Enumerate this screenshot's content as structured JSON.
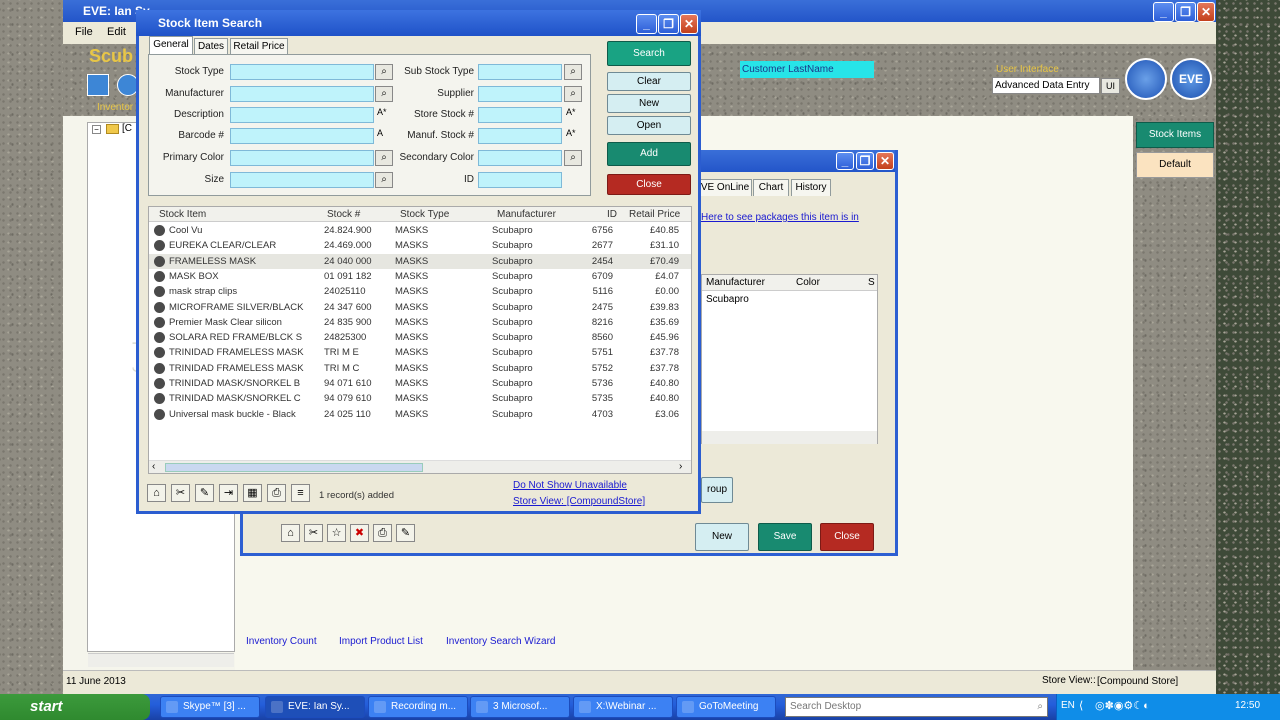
{
  "app": {
    "title": "EVE: Ian Sy",
    "title_suffix": "...",
    "menu": [
      "File",
      "Edit"
    ],
    "banner_title": "Scub",
    "side_text": "EVE Electronic Virtual Employee 5.8",
    "tree_root": "[C",
    "inventory_tab": "Inventor",
    "customer_label": "Customer LastName",
    "user_interface_label": "User Interface",
    "user_interface_value": "Advanced Data Entry",
    "ui_button": "UI",
    "right_buttons": [
      "Stock Items",
      "Default"
    ],
    "bottom_links": [
      "Inventory Count",
      "Import Product List",
      "Inventory Search Wizard"
    ],
    "status_date": "11 June 2013",
    "status_store_label": "Store View::",
    "status_store_value": "[Compound Store]",
    "logo_text": "EVE"
  },
  "edit_window": {
    "tabs": [
      "VE OnLine",
      "Chart",
      "History"
    ],
    "link": "Here to see packages this item is in",
    "columns": [
      "Manufacturer",
      "Color",
      "S"
    ],
    "row_manufacturer": "Scubapro",
    "group_button": "roup",
    "buttons": {
      "new": "New",
      "save": "Save",
      "close": "Close"
    }
  },
  "dialog": {
    "title": "Stock Item Search",
    "tabs": [
      "General",
      "Dates",
      "Retail Price"
    ],
    "fields_left": [
      {
        "label": "Stock Type",
        "lookup": true
      },
      {
        "label": "Manufacturer",
        "lookup": true
      },
      {
        "label": "Description",
        "lookup": false,
        "mark": "A*"
      },
      {
        "label": "Barcode #",
        "lookup": false,
        "mark": "A"
      },
      {
        "label": "Primary Color",
        "lookup": true
      },
      {
        "label": "Size",
        "lookup": true
      }
    ],
    "fields_right": [
      {
        "label": "Sub Stock Type",
        "lookup": true
      },
      {
        "label": "Supplier",
        "lookup": true
      },
      {
        "label": "Store Stock #",
        "lookup": false,
        "mark": "A*"
      },
      {
        "label": "Manuf. Stock #",
        "lookup": false,
        "mark": "A*"
      },
      {
        "label": "Secondary Color",
        "lookup": true
      },
      {
        "label": "ID",
        "lookup": false
      }
    ],
    "buttons": {
      "search": "Search",
      "clear": "Clear",
      "new": "New",
      "open": "Open",
      "add": "Add",
      "close": "Close"
    },
    "columns": [
      "Stock Item",
      "Stock #",
      "Stock Type",
      "Manufacturer",
      "ID",
      "Retail Price"
    ],
    "rows": [
      [
        "Cool Vu",
        "24.824.900",
        "MASKS",
        "Scubapro",
        "6756",
        "£40.85"
      ],
      [
        "EUREKA CLEAR/CLEAR",
        "24.469.000",
        "MASKS",
        "Scubapro",
        "2677",
        "£31.10"
      ],
      [
        "FRAMELESS MASK",
        "24 040 000",
        "MASKS",
        "Scubapro",
        "2454",
        "£70.49"
      ],
      [
        "MASK BOX",
        "01 091 182",
        "MASKS",
        "Scubapro",
        "6709",
        "£4.07"
      ],
      [
        "mask strap clips",
        "24025110",
        "MASKS",
        "Scubapro",
        "5116",
        "£0.00"
      ],
      [
        "MICROFRAME SILVER/BLACK",
        "24 347 600",
        "MASKS",
        "Scubapro",
        "2475",
        "£39.83"
      ],
      [
        "Premier Mask Clear silicon",
        "24 835 900",
        "MASKS",
        "Scubapro",
        "8216",
        "£35.69"
      ],
      [
        "SOLARA RED FRAME/BLCK S",
        "24825300",
        "MASKS",
        "Scubapro",
        "8560",
        "£45.96"
      ],
      [
        "TRINIDAD FRAMELESS MASK",
        "TRI M E",
        "MASKS",
        "Scubapro",
        "5751",
        "£37.78"
      ],
      [
        "TRINIDAD FRAMELESS MASK",
        "TRI M C",
        "MASKS",
        "Scubapro",
        "5752",
        "£37.78"
      ],
      [
        "TRINIDAD MASK/SNORKEL B",
        "94 071 610",
        "MASKS",
        "Scubapro",
        "5736",
        "£40.80"
      ],
      [
        "TRINIDAD MASK/SNORKEL C",
        "94 079 610",
        "MASKS",
        "Scubapro",
        "5735",
        "£40.80"
      ],
      [
        "Universal mask buckle - Black",
        "24 025 110",
        "MASKS",
        "Scubapro",
        "4703",
        "£3.06"
      ]
    ],
    "selected_row": 2,
    "record_status": "1 record(s) added",
    "link_unavailable": "Do Not Show Unavailable",
    "link_store": "Store View: [CompoundStore]"
  },
  "taskbar": {
    "start": "start",
    "items": [
      "Skype™ [3] ...",
      "EVE: Ian Sy...",
      "Recording m...",
      "3 Microsof...",
      "X:\\Webinar ...",
      "GoToMeeting"
    ],
    "active": 1,
    "search_placeholder": "Search Desktop",
    "lang": "EN",
    "clock": "12:50"
  },
  "colors": {
    "accent": "#2355c9",
    "field": "#bff3fb",
    "save_green": "#188a70",
    "close_red": "#b52a22"
  }
}
